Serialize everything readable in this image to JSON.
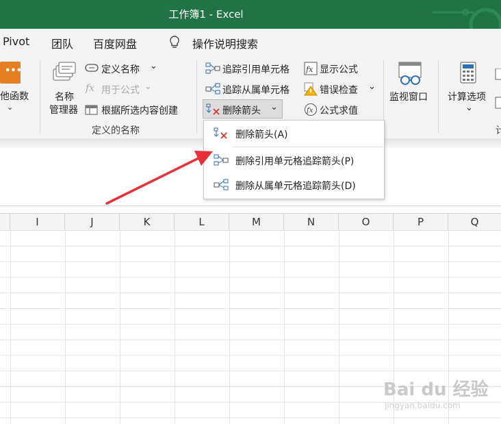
{
  "window": {
    "title": "工作簿1  -  Excel"
  },
  "menubar": {
    "tabs": [
      "Pivot",
      "团队",
      "百度网盘"
    ],
    "tell_me": "操作说明搜索"
  },
  "ribbon": {
    "more_functions": "他函数",
    "name_manager_line1": "名称",
    "name_manager_line2": "管理器",
    "define_name": "定义名称",
    "use_in_formula": "用于公式",
    "create_from_selection": "根据所选内容创建",
    "defined_names_group": "定义的名称",
    "trace_precedents": "追踪引用单元格",
    "trace_dependents": "追踪从属单元格",
    "remove_arrows": "删除箭头",
    "show_formulas": "显示公式",
    "error_checking": "错误检查",
    "evaluate_formula": "公式求值",
    "watch_window": "监视窗口",
    "calc_options": "计算选项",
    "calc_group_partial": "计"
  },
  "dropdown": {
    "items": [
      "删除箭头(A)",
      "删除引用单元格追踪箭头(P)",
      "删除从属单元格追踪箭头(D)"
    ]
  },
  "columns": [
    "I",
    "J",
    "K",
    "L",
    "M",
    "N",
    "O",
    "P",
    "Q"
  ],
  "watermark": {
    "brand": "Bai du 经验",
    "url": "jingyan.baidu.com"
  },
  "colors": {
    "title_bar": "#217346",
    "arrow": "#e8303a",
    "ribbon_bg": "#f3f3f3"
  }
}
